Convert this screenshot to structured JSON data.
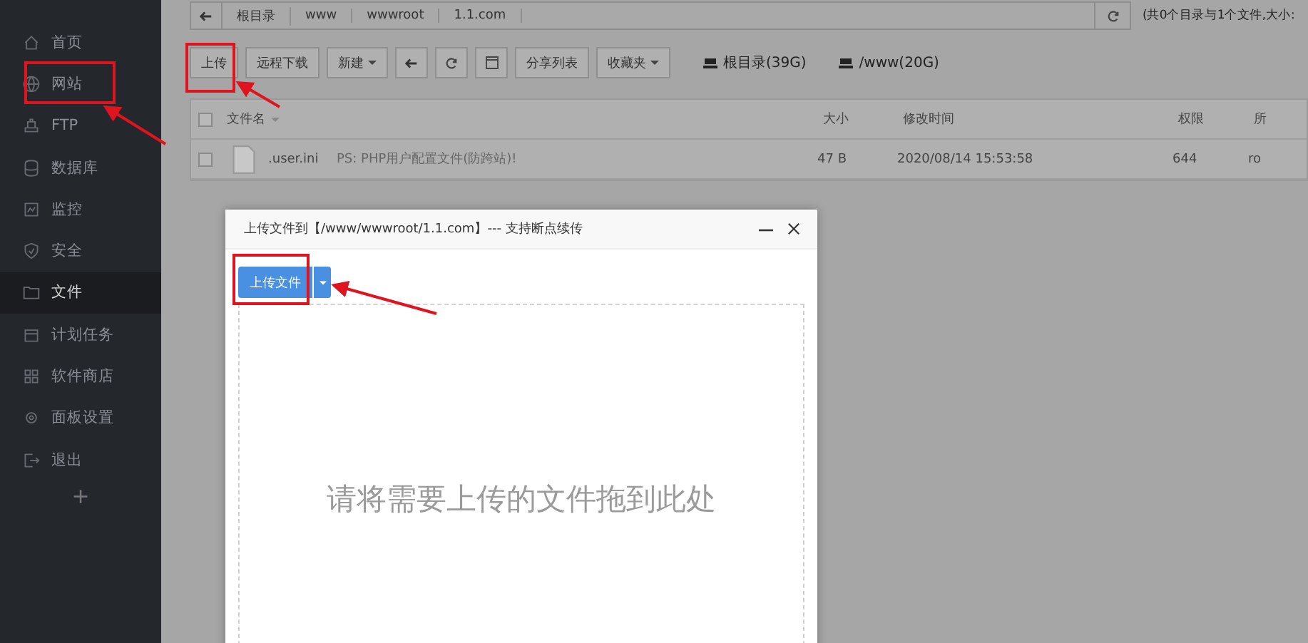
{
  "sidebar": {
    "items": [
      {
        "label": "首页",
        "selected": false
      },
      {
        "label": "网站",
        "selected": false
      },
      {
        "label": "FTP",
        "selected": false
      },
      {
        "label": "数据库",
        "selected": false
      },
      {
        "label": "监控",
        "selected": false
      },
      {
        "label": "安全",
        "selected": false
      },
      {
        "label": "文件",
        "selected": true
      },
      {
        "label": "计划任务",
        "selected": false
      },
      {
        "label": "软件商店",
        "selected": false
      },
      {
        "label": "面板设置",
        "selected": false
      },
      {
        "label": "退出",
        "selected": false
      }
    ],
    "add": "+"
  },
  "breadcrumb": [
    "根目录",
    "www",
    "wwwroot",
    "1.1.com"
  ],
  "summary": "(共0个目录与1个文件,大小:",
  "toolbar": {
    "buttons": [
      {
        "label": "上传",
        "kind": "text"
      },
      {
        "label": "远程下载",
        "kind": "text"
      },
      {
        "label": "新建",
        "kind": "dropdown"
      },
      {
        "kind": "back"
      },
      {
        "kind": "refresh"
      },
      {
        "kind": "terminal"
      },
      {
        "label": "分享列表",
        "kind": "text"
      },
      {
        "label": "收藏夹",
        "kind": "dropdown"
      }
    ],
    "disks": [
      "根目录(39G)",
      "/www(20G)"
    ]
  },
  "table": {
    "header_checkbox": {
      "checked": false
    },
    "columns": [
      "文件名",
      "大小",
      "修改时间",
      "权限",
      "所"
    ],
    "rows": [
      {
        "checked": false,
        "name": ".user.ini",
        "note": "PS: PHP用户配置文件(防跨站)!",
        "size": "47 B",
        "mtime": "2020/08/14 15:53:58",
        "perm": "644",
        "owner": "ro"
      }
    ]
  },
  "dialog": {
    "title": "上传文件到【/www/wwwroot/1.1.com】--- 支持断点续传",
    "upload_button": "上传文件",
    "drop_hint": "请将需要上传的文件拖到此处"
  }
}
